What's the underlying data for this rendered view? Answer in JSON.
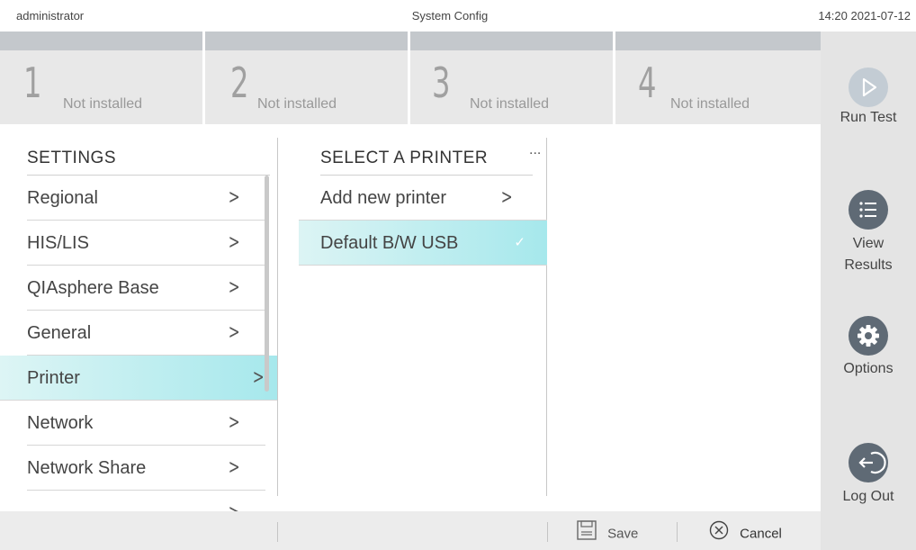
{
  "header": {
    "user": "administrator",
    "title": "System Config",
    "datetime": "14:20 2021-07-12"
  },
  "modules": [
    {
      "number": "1",
      "status": "Not installed"
    },
    {
      "number": "2",
      "status": "Not installed"
    },
    {
      "number": "3",
      "status": "Not installed"
    },
    {
      "number": "4",
      "status": "Not installed"
    }
  ],
  "sidebar": {
    "run_test": "Run Test",
    "view_results_line1": "View",
    "view_results_line2": "Results",
    "options": "Options",
    "log_out": "Log Out"
  },
  "settings": {
    "heading": "SETTINGS",
    "items": [
      {
        "label": "Regional"
      },
      {
        "label": "HIS/LIS"
      },
      {
        "label": "QIAsphere Base"
      },
      {
        "label": "General"
      },
      {
        "label": "Printer"
      },
      {
        "label": "Network"
      },
      {
        "label": "Network Share"
      }
    ],
    "active_item": "Printer"
  },
  "printers": {
    "heading": "SELECT A PRINTER",
    "more": "...",
    "items": [
      {
        "label": "Add new printer"
      },
      {
        "label": "Default B/W USB"
      }
    ],
    "selected_item": "Default B/W USB"
  },
  "footer": {
    "save": "Save",
    "cancel": "Cancel"
  },
  "colors": {
    "selection_gradient_end": "#a6e8ec",
    "sidebar_icon": "#5f6a75",
    "sidebar_bg": "#e4e4e4"
  }
}
